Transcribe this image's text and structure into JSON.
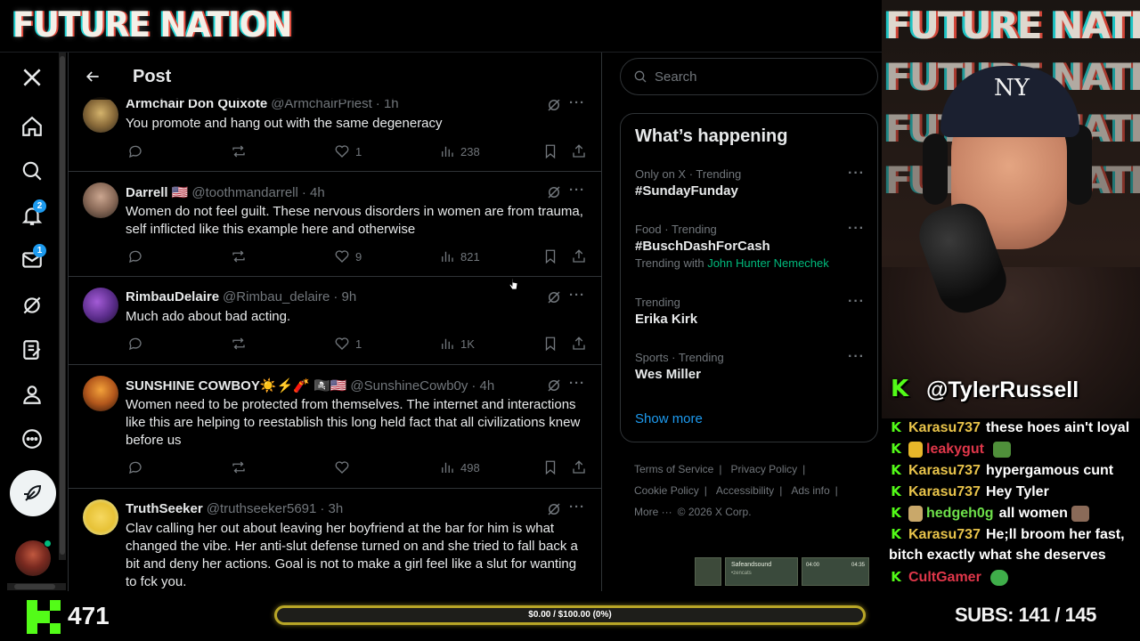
{
  "stream": {
    "brand": "FUTURE NATION",
    "streamer_handle": "@TylerRussell",
    "follower_count": "471",
    "goal_text": "$0.00 / $100.00 (0%)",
    "goal_progress": 0,
    "subs_text": "SUBS:  141 / 145",
    "kick_color": "#53fc18"
  },
  "nav": {
    "notifications_badge": "2",
    "messages_badge": "1"
  },
  "header": {
    "title": "Post"
  },
  "tweets": [
    {
      "name": "Armchair Don Quixote",
      "handle": "@ArmchairPriest",
      "time": "· 1h",
      "text": "You promote and hang out with the same degeneracy",
      "likes": "1",
      "views": "238"
    },
    {
      "name": "Darrell 🇺🇸",
      "handle": "@toothmandarrell",
      "time": "· 4h",
      "text": "Women do not feel guilt. These nervous disorders in women are from trauma, self inflicted like this example here and otherwise",
      "likes": "9",
      "views": "821"
    },
    {
      "name": "RimbauDelaire",
      "handle": "@Rimbau_delaire",
      "time": "· 9h",
      "text": "Much ado about bad acting.",
      "likes": "1",
      "views": "1K"
    },
    {
      "name": "SUNSHINE COWBOY☀️⚡️🧨 🏴‍☠️🇺🇸",
      "handle": "@SunshineCowb0y",
      "time": "· 4h",
      "text": "Women need to be protected from themselves. The internet and interactions like this are helping to reestablish this long held fact that all civilizations knew before us",
      "likes": "",
      "views": "498"
    },
    {
      "name": "TruthSeeker",
      "handle": "@truthseeker5691",
      "time": "· 3h",
      "text": "Clav calling her out about leaving her boyfriend at the bar for him is what changed the vibe. Her anti-slut defense turned on and she tried to fall back a bit and deny her actions. Goal is not to make a girl feel like a slut for wanting to fck you.",
      "likes": "",
      "views": ""
    }
  ],
  "search": {
    "placeholder": "Search"
  },
  "trends": {
    "title": "What’s happening",
    "items": [
      {
        "context": "Only on X · Trending",
        "topic": "#SundayFunday",
        "with_label": "",
        "with_name": ""
      },
      {
        "context": "Food · Trending",
        "topic": "#BuschDashForCash",
        "with_label": "Trending with",
        "with_name": "John Hunter Nemechek"
      },
      {
        "context": "Trending",
        "topic": "Erika Kirk",
        "with_label": "",
        "with_name": ""
      },
      {
        "context": "Sports · Trending",
        "topic": "Wes Miller",
        "with_label": "",
        "with_name": ""
      }
    ],
    "show_more": "Show more"
  },
  "footer": {
    "terms": "Terms of Service",
    "privacy": "Privacy Policy",
    "cookie": "Cookie Policy",
    "accessibility": "Accessibility",
    "ads": "Ads info",
    "more": "More ···",
    "copyright": "© 2026 X Corp."
  },
  "mini_player": {
    "title": "Safeandsound",
    "subtitle": "•zencats",
    "time_start": "04:00",
    "time_end": "04:35"
  },
  "chat": [
    {
      "user": "Karasu737",
      "text": "these hoes ain't loyal",
      "color": "gold"
    },
    {
      "user": "leakygut",
      "text": "",
      "color": "red"
    },
    {
      "user": "Karasu737",
      "text": "hypergamous cunt",
      "color": "gold"
    },
    {
      "user": "Karasu737",
      "text": "Hey Tyler",
      "color": "gold"
    },
    {
      "user": "hedgeh0g",
      "text": "all women",
      "color": "green"
    },
    {
      "user": "Karasu737",
      "text": "He;ll broom her fast,",
      "color": "gold"
    },
    {
      "user": "",
      "text": "bitch exactly what she deserves",
      "color": ""
    },
    {
      "user": "CultGamer",
      "text": "",
      "color": "red"
    }
  ]
}
